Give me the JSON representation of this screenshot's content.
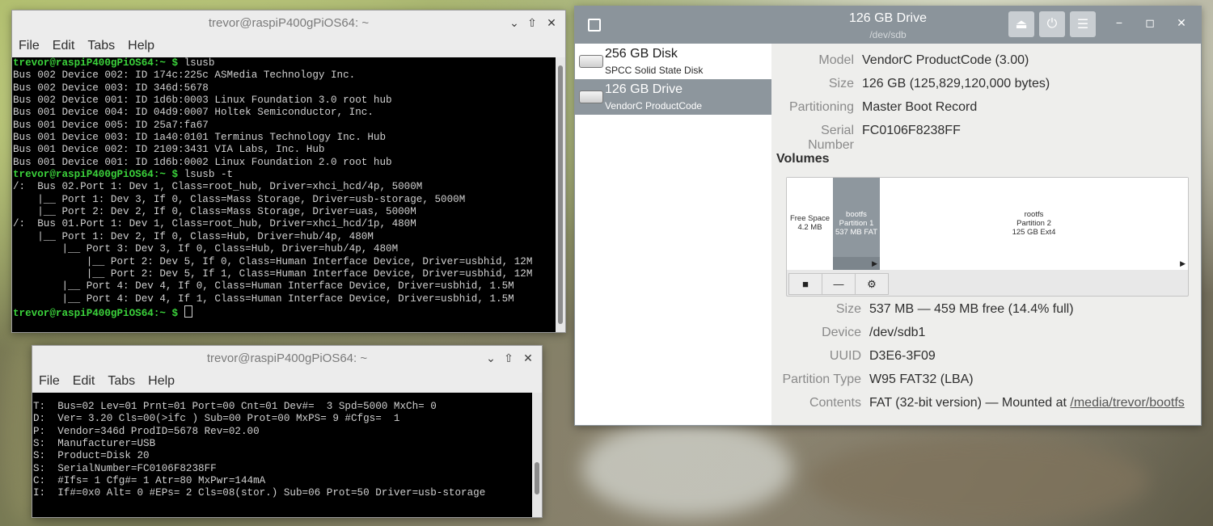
{
  "term1": {
    "title": "trevor@raspiP400gPiOS64: ~",
    "menu": [
      "File",
      "Edit",
      "Tabs",
      "Help"
    ],
    "lines": [
      {
        "prompt": "trevor@raspiP400gPiOS64:~ $",
        "text": " lsusb"
      },
      {
        "prompt": "",
        "text": "Bus 002 Device 002: ID 174c:225c ASMedia Technology Inc."
      },
      {
        "prompt": "",
        "text": "Bus 002 Device 003: ID 346d:5678"
      },
      {
        "prompt": "",
        "text": "Bus 002 Device 001: ID 1d6b:0003 Linux Foundation 3.0 root hub"
      },
      {
        "prompt": "",
        "text": "Bus 001 Device 004: ID 04d9:0007 Holtek Semiconductor, Inc."
      },
      {
        "prompt": "",
        "text": "Bus 001 Device 005: ID 25a7:fa67"
      },
      {
        "prompt": "",
        "text": "Bus 001 Device 003: ID 1a40:0101 Terminus Technology Inc. Hub"
      },
      {
        "prompt": "",
        "text": "Bus 001 Device 002: ID 2109:3431 VIA Labs, Inc. Hub"
      },
      {
        "prompt": "",
        "text": "Bus 001 Device 001: ID 1d6b:0002 Linux Foundation 2.0 root hub"
      },
      {
        "prompt": "trevor@raspiP400gPiOS64:~ $",
        "text": " lsusb -t"
      },
      {
        "prompt": "",
        "text": "/:  Bus 02.Port 1: Dev 1, Class=root_hub, Driver=xhci_hcd/4p, 5000M"
      },
      {
        "prompt": "",
        "text": "    |__ Port 1: Dev 3, If 0, Class=Mass Storage, Driver=usb-storage, 5000M"
      },
      {
        "prompt": "",
        "text": "    |__ Port 2: Dev 2, If 0, Class=Mass Storage, Driver=uas, 5000M"
      },
      {
        "prompt": "",
        "text": "/:  Bus 01.Port 1: Dev 1, Class=root_hub, Driver=xhci_hcd/1p, 480M"
      },
      {
        "prompt": "",
        "text": "    |__ Port 1: Dev 2, If 0, Class=Hub, Driver=hub/4p, 480M"
      },
      {
        "prompt": "",
        "text": "        |__ Port 3: Dev 3, If 0, Class=Hub, Driver=hub/4p, 480M"
      },
      {
        "prompt": "",
        "text": "            |__ Port 2: Dev 5, If 0, Class=Human Interface Device, Driver=usbhid, 12M"
      },
      {
        "prompt": "",
        "text": "            |__ Port 2: Dev 5, If 1, Class=Human Interface Device, Driver=usbhid, 12M"
      },
      {
        "prompt": "",
        "text": "        |__ Port 4: Dev 4, If 0, Class=Human Interface Device, Driver=usbhid, 1.5M"
      },
      {
        "prompt": "",
        "text": "        |__ Port 4: Dev 4, If 1, Class=Human Interface Device, Driver=usbhid, 1.5M"
      },
      {
        "prompt": "trevor@raspiP400gPiOS64:~ $",
        "text": " ",
        "cursor": true
      }
    ]
  },
  "term2": {
    "title": "trevor@raspiP400gPiOS64: ~",
    "menu": [
      "File",
      "Edit",
      "Tabs",
      "Help"
    ],
    "lines": [
      "",
      "T:  Bus=02 Lev=01 Prnt=01 Port=00 Cnt=01 Dev#=  3 Spd=5000 MxCh= 0",
      "D:  Ver= 3.20 Cls=00(>ifc ) Sub=00 Prot=00 MxPS= 9 #Cfgs=  1",
      "P:  Vendor=346d ProdID=5678 Rev=02.00",
      "S:  Manufacturer=USB",
      "S:  Product=Disk 20",
      "S:  SerialNumber=FC0106F8238FF",
      "C:  #Ifs= 1 Cfg#= 1 Atr=80 MxPwr=144mA",
      "I:  If#=0x0 Alt= 0 #EPs= 2 Cls=08(stor.) Sub=06 Prot=50 Driver=usb-storage"
    ]
  },
  "disks": {
    "title": "126 GB Drive",
    "subtitle": "/dev/sdb",
    "devices": [
      {
        "name": "256 GB Disk",
        "sub": "SPCC Solid State Disk"
      },
      {
        "name": "126 GB Drive",
        "sub": "VendorC ProductCode"
      }
    ],
    "drive_info": [
      {
        "key": "Model",
        "value": "VendorC ProductCode (3.00)"
      },
      {
        "key": "Size",
        "value": "126 GB (125,829,120,000 bytes)"
      },
      {
        "key": "Partitioning",
        "value": "Master Boot Record"
      },
      {
        "key": "Serial Number",
        "value": "FC0106F8238FF"
      }
    ],
    "volumes_heading": "Volumes",
    "segments": [
      {
        "lines": [
          "Free Space",
          "4.2 MB"
        ]
      },
      {
        "lines": [
          "bootfs",
          "Partition 1",
          "537 MB FAT"
        ]
      },
      {
        "lines": [
          "rootfs",
          "Partition 2",
          "125 GB Ext4"
        ]
      }
    ],
    "volume_info": [
      {
        "key": "Size",
        "value": "537 MB — 459 MB free (14.4% full)"
      },
      {
        "key": "Device",
        "value": "/dev/sdb1"
      },
      {
        "key": "UUID",
        "value": "D3E6-3F09"
      },
      {
        "key": "Partition Type",
        "value": "W95 FAT32 (LBA)"
      },
      {
        "key": "Contents",
        "value": "FAT (32-bit version) — Mounted at ",
        "link": "/media/trevor/bootfs"
      }
    ]
  }
}
